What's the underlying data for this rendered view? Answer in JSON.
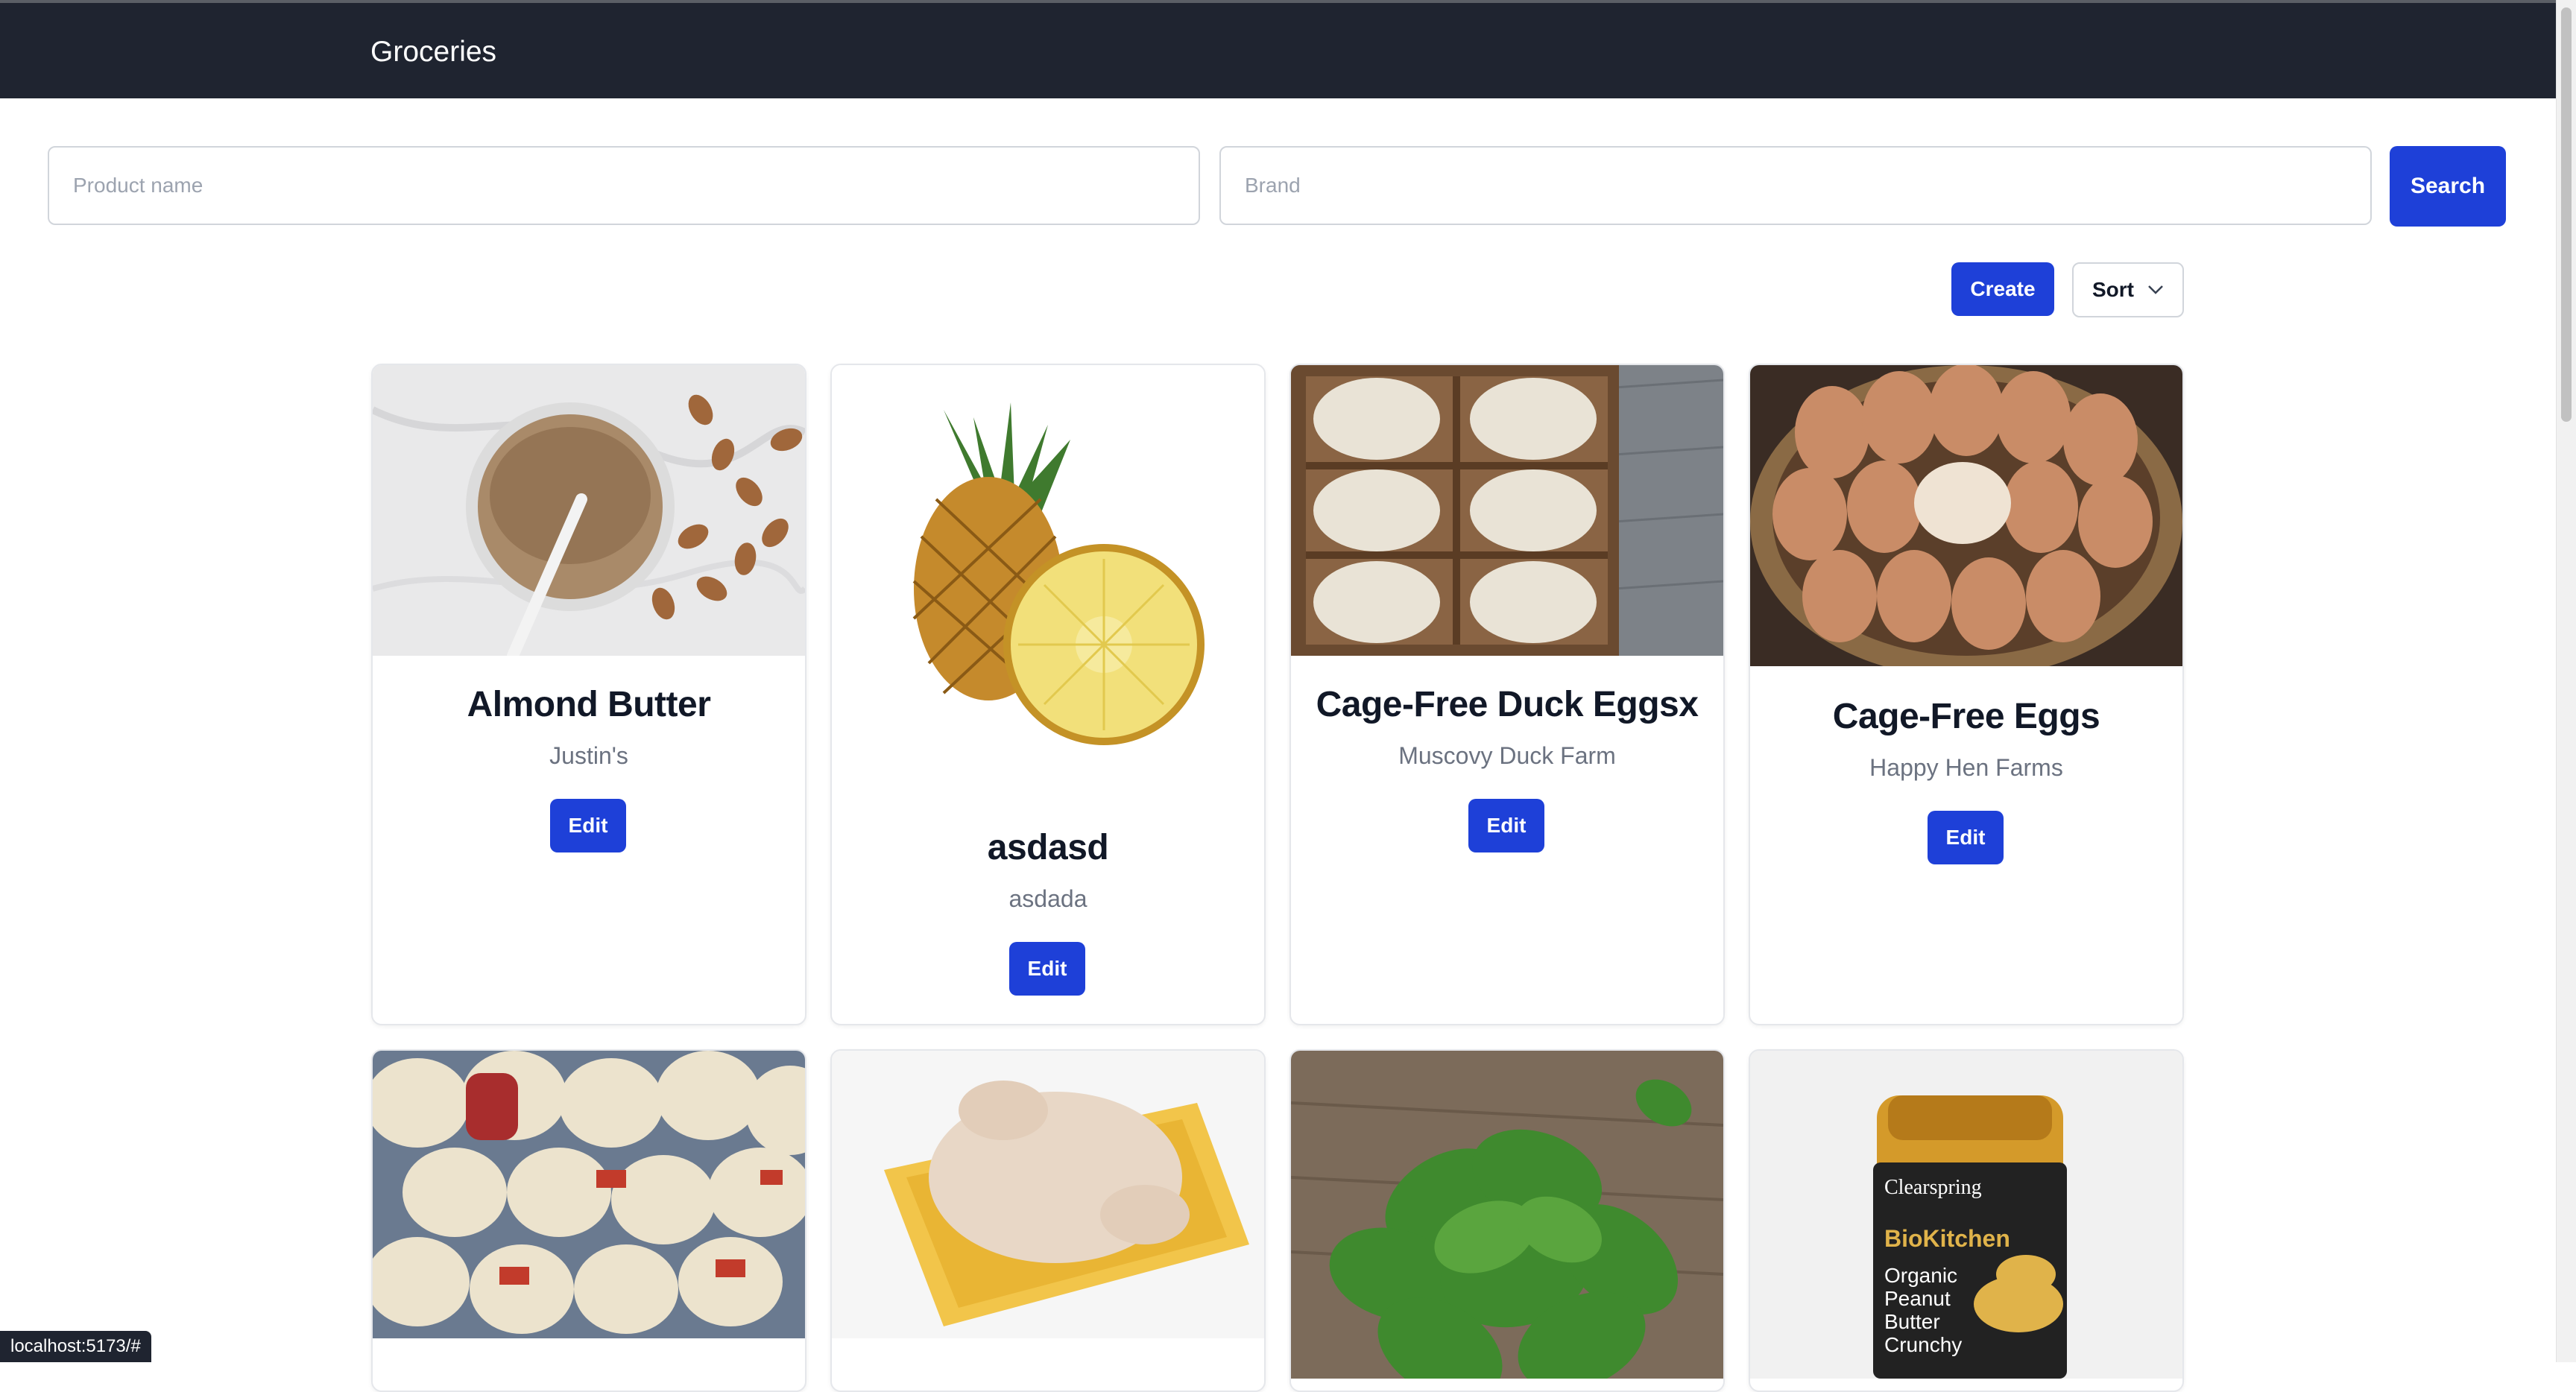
{
  "app": {
    "title": "Groceries"
  },
  "search": {
    "product_placeholder": "Product name",
    "brand_placeholder": "Brand",
    "search_label": "Search"
  },
  "toolbar": {
    "create_label": "Create",
    "sort_label": "Sort"
  },
  "products": [
    {
      "name": "Almond Butter",
      "brand": "Justin's",
      "edit_label": "Edit",
      "image": "almond-butter-jar-photo"
    },
    {
      "name": "asdasd",
      "brand": "asdada",
      "edit_label": "Edit",
      "image": "pineapple-photo"
    },
    {
      "name": "Cage-Free Duck Eggsx",
      "brand": "Muscovy Duck Farm",
      "edit_label": "Edit",
      "image": "duck-eggs-box-photo"
    },
    {
      "name": "Cage-Free Eggs",
      "brand": "Happy Hen Farms",
      "edit_label": "Edit",
      "image": "eggs-basket-photo"
    }
  ],
  "products_row2": [
    {
      "image": "packaged-turkeys-photo"
    },
    {
      "image": "raw-chicken-tray-photo"
    },
    {
      "image": "spinach-photo"
    },
    {
      "image": "peanut-butter-jar-photo",
      "label_brand": "Clearspring",
      "label_line": "BioKitchen",
      "label_text": "Organic Peanut Butter Crunchy"
    }
  ],
  "status_url": "localhost:5173/#"
}
